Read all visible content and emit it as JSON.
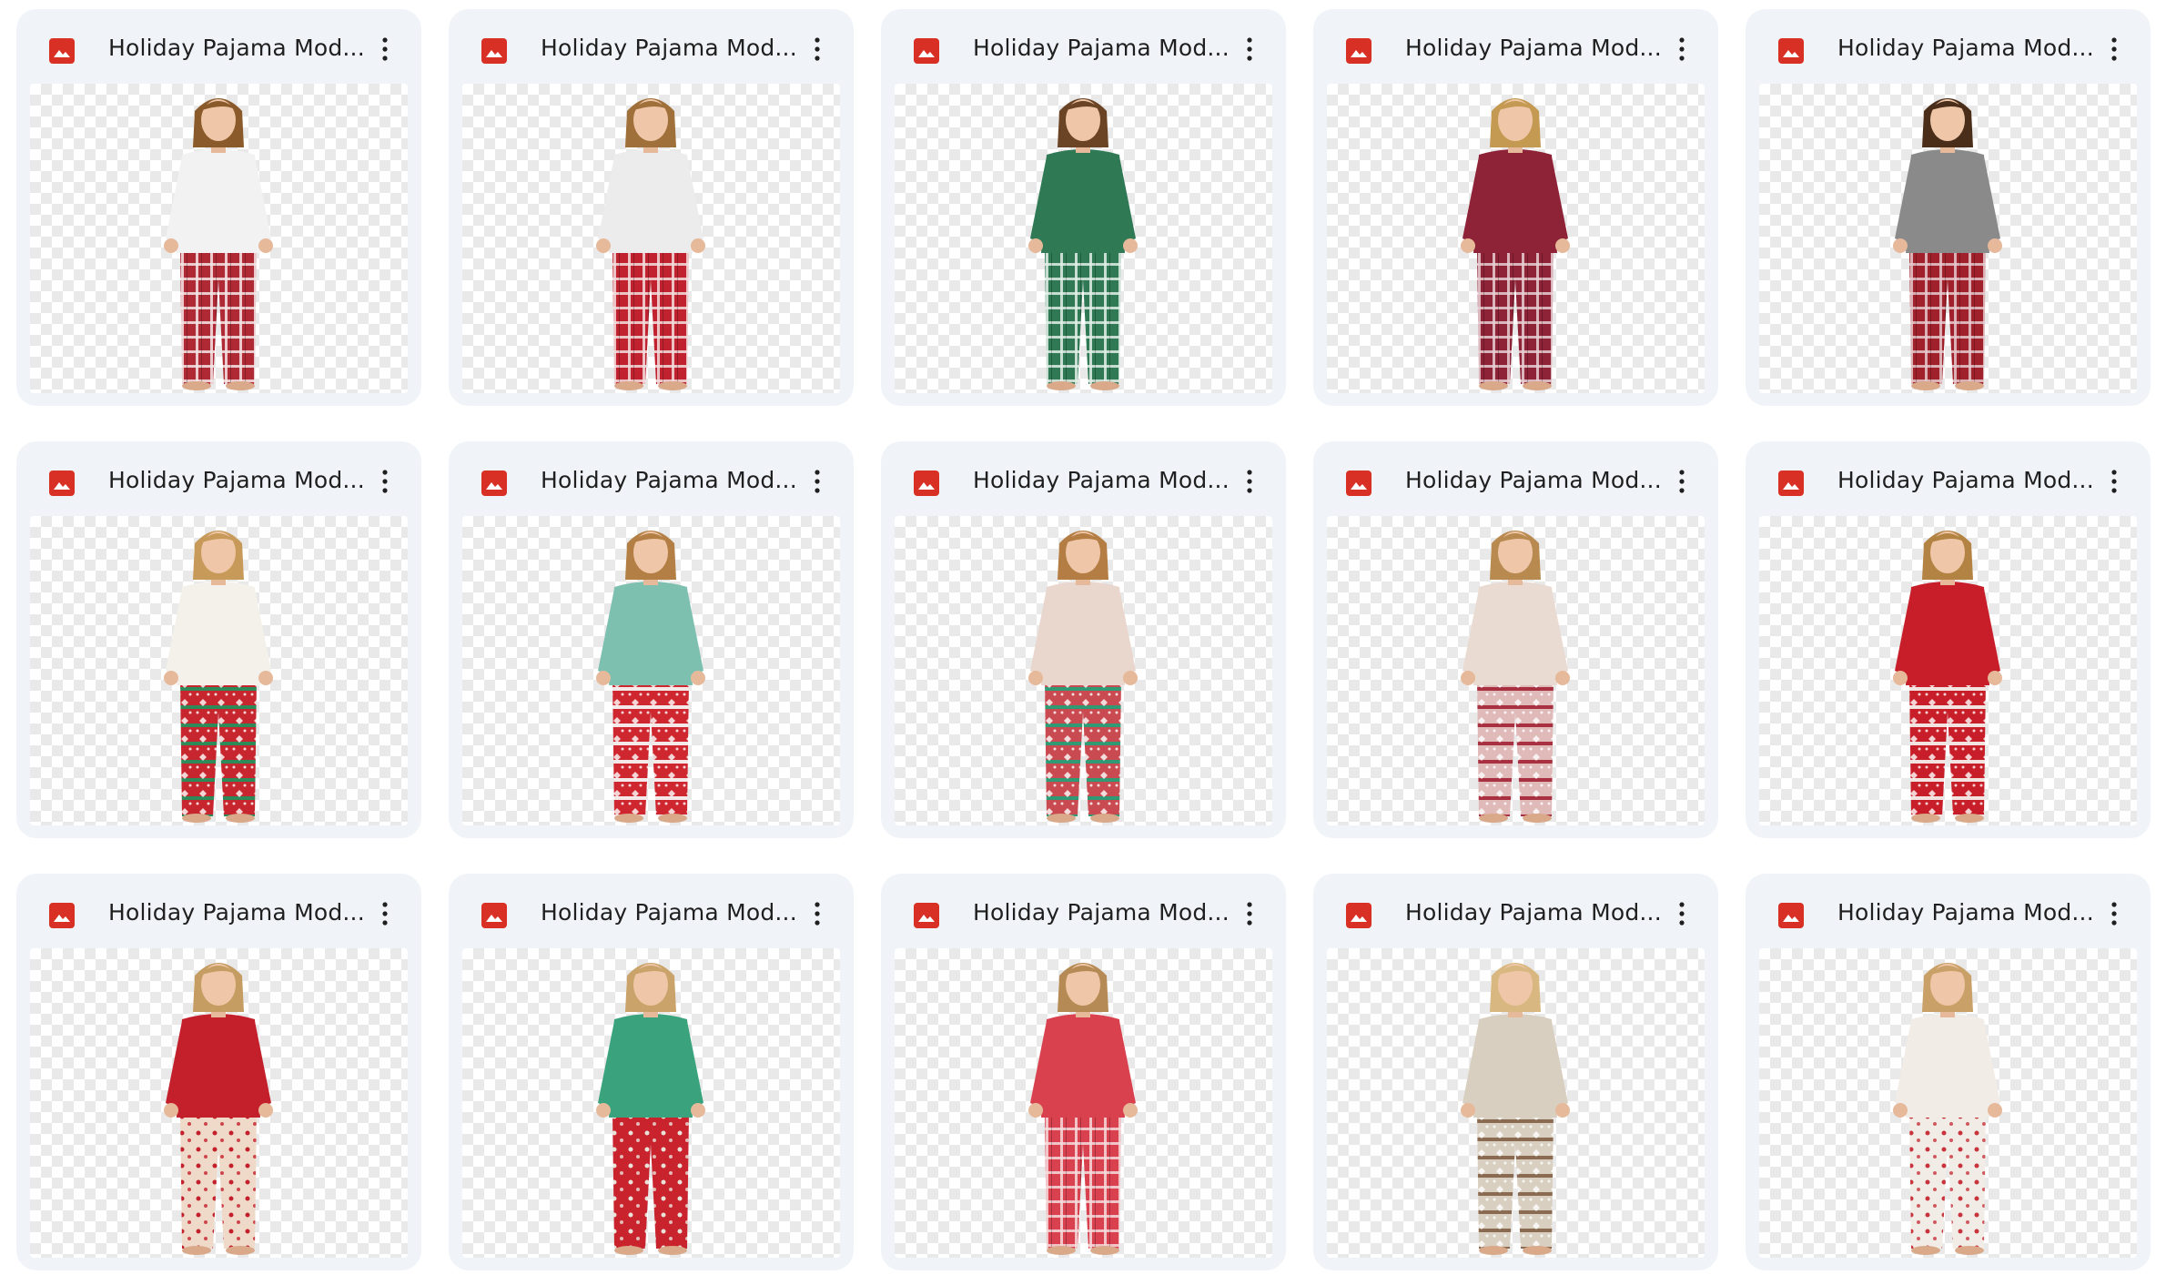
{
  "colors": {
    "card_bg": "#f0f4f9",
    "image_icon": "#d93025",
    "text": "#1f1f1f"
  },
  "files": [
    {
      "name": "Holiday Pajama Mod...",
      "icon": "image-file-icon",
      "figure": {
        "hair": "#8a5a2b",
        "top": "#f2f2f2",
        "pants": "#b02a35",
        "pants_alt": "#f5e6e6",
        "pattern": "plaid"
      }
    },
    {
      "name": "Holiday Pajama Mod...",
      "icon": "image-file-icon",
      "figure": {
        "hair": "#a0703a",
        "top": "#ececec",
        "pants": "#c0232f",
        "pants_alt": "#f3dede",
        "pattern": "plaid"
      }
    },
    {
      "name": "Holiday Pajama Mod...",
      "icon": "image-file-icon",
      "figure": {
        "hair": "#6b4426",
        "top": "#2f7a55",
        "pants": "#2f7a55",
        "pants_alt": "#e3efe8",
        "pattern": "plaid"
      }
    },
    {
      "name": "Holiday Pajama Mod...",
      "icon": "image-file-icon",
      "figure": {
        "hair": "#c49a52",
        "top": "#8e2236",
        "pants": "#8e2236",
        "pants_alt": "#e8cfd4",
        "pattern": "plaid"
      }
    },
    {
      "name": "Holiday Pajama Mod...",
      "icon": "image-file-icon",
      "figure": {
        "hair": "#4a2e1a",
        "top": "#8a8a8a",
        "pants": "#a0212c",
        "pants_alt": "#e5c9cb",
        "pattern": "plaid"
      }
    },
    {
      "name": "Holiday Pajama Mod...",
      "icon": "image-file-icon",
      "figure": {
        "hair": "#c79a5a",
        "top": "#f4f1ea",
        "pants": "#c7262e",
        "pants_alt": "#2f8a5a",
        "pattern": "fair-isle"
      }
    },
    {
      "name": "Holiday Pajama Mod...",
      "icon": "image-file-icon",
      "figure": {
        "hair": "#b37f45",
        "top": "#7dc0b0",
        "pants": "#cf2730",
        "pants_alt": "#f4e8e8",
        "pattern": "fair-isle"
      }
    },
    {
      "name": "Holiday Pajama Mod...",
      "icon": "image-file-icon",
      "figure": {
        "hair": "#b47d44",
        "top": "#e9d6cc",
        "pants": "#c94a50",
        "pants_alt": "#2f9a74",
        "pattern": "fair-isle"
      }
    },
    {
      "name": "Holiday Pajama Mod...",
      "icon": "image-file-icon",
      "figure": {
        "hair": "#b88a50",
        "top": "#eadbd2",
        "pants": "#e0b9b9",
        "pants_alt": "#a83040",
        "pattern": "fair-isle"
      }
    },
    {
      "name": "Holiday Pajama Mod...",
      "icon": "image-file-icon",
      "figure": {
        "hair": "#b38343",
        "top": "#c81e2a",
        "pants": "#c81e2a",
        "pants_alt": "#f2e2e0",
        "pattern": "fair-isle"
      }
    },
    {
      "name": "Holiday Pajama Mod...",
      "icon": "image-file-icon",
      "figure": {
        "hair": "#c59d62",
        "top": "#c4202c",
        "pants": "#efd9c8",
        "pants_alt": "#c4202c",
        "pattern": "floral"
      }
    },
    {
      "name": "Holiday Pajama Mod...",
      "icon": "image-file-icon",
      "figure": {
        "hair": "#c9a36a",
        "top": "#3aa37e",
        "pants": "#c9232e",
        "pants_alt": "#e9e2d8",
        "pattern": "floral"
      }
    },
    {
      "name": "Holiday Pajama Mod...",
      "icon": "image-file-icon",
      "figure": {
        "hair": "#b58a55",
        "top": "#d9414f",
        "pants": "#d9414f",
        "pants_alt": "#f6dcdc",
        "pattern": "plaid"
      }
    },
    {
      "name": "Holiday Pajama Mod...",
      "icon": "image-file-icon",
      "figure": {
        "hair": "#d8b880",
        "top": "#d9cfc0",
        "pants": "#d9cfc0",
        "pants_alt": "#8a6a50",
        "pattern": "fair-isle"
      }
    },
    {
      "name": "Holiday Pajama Mod...",
      "icon": "image-file-icon",
      "figure": {
        "hair": "#c9a068",
        "top": "#f1ece6",
        "pants": "#f1ece6",
        "pants_alt": "#c8333c",
        "pattern": "floral"
      }
    }
  ]
}
